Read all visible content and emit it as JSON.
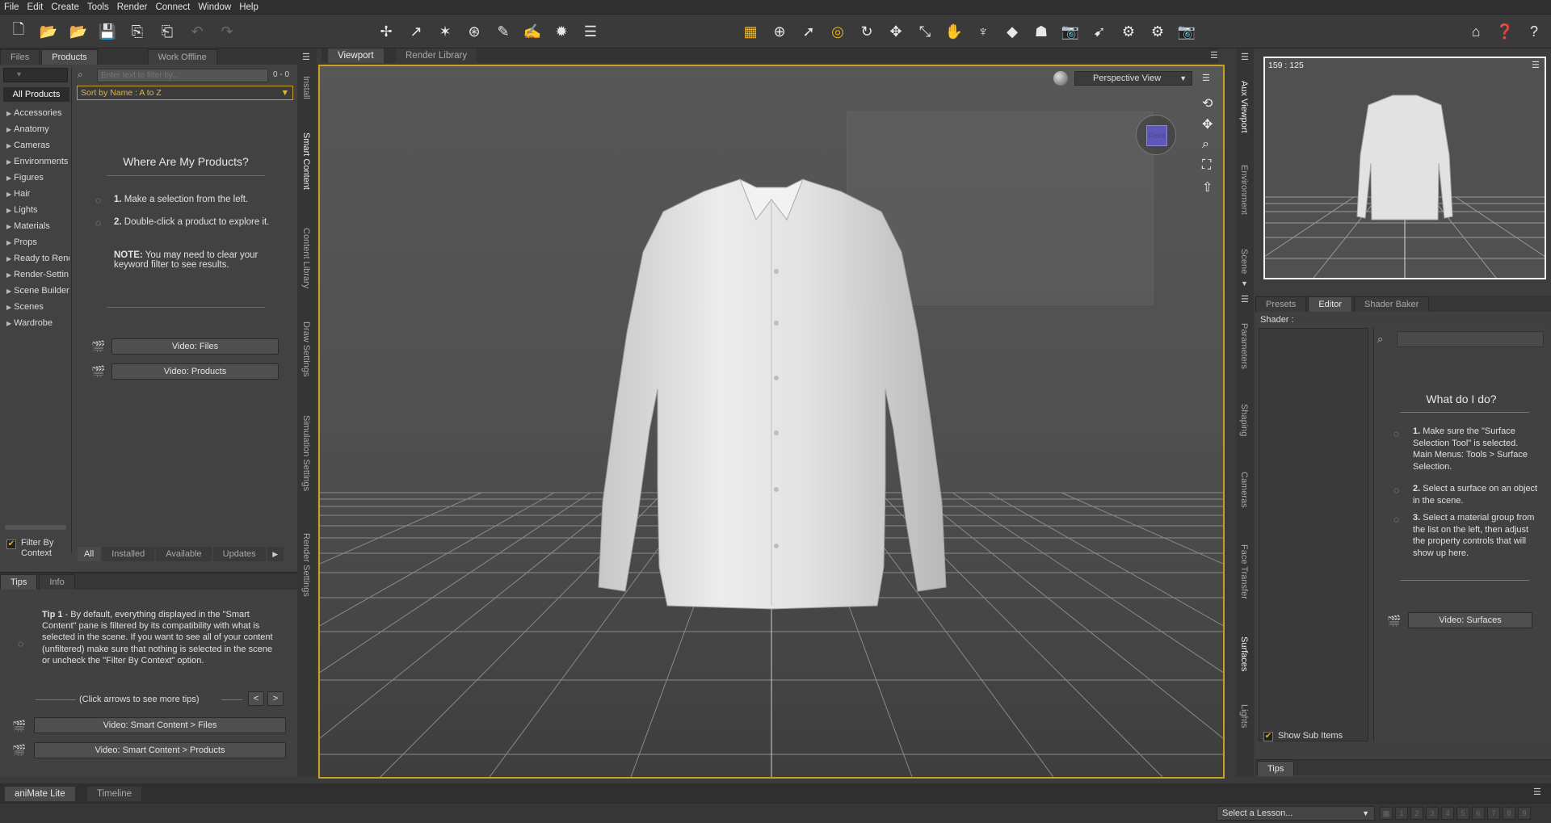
{
  "menu": [
    "File",
    "Edit",
    "Create",
    "Tools",
    "Render",
    "Connect",
    "Window",
    "Help"
  ],
  "left": {
    "tabs": {
      "files": "Files",
      "products": "Products",
      "offline": "Work Offline"
    },
    "filter_placeholder": "Enter text to filter by...",
    "filter_count": "0 - 0",
    "sort": "Sort by Name : A to Z",
    "all_products": "All Products",
    "categories": [
      "Accessories",
      "Anatomy",
      "Cameras",
      "Environments",
      "Figures",
      "Hair",
      "Lights",
      "Materials",
      "Props",
      "Ready to Rend",
      "Render-Settin",
      "Scene Builder",
      "Scenes",
      "Wardrobe"
    ],
    "where_title": "Where Are My Products?",
    "step1_num": "1.",
    "step1": "Make a selection from the left.",
    "step2_num": "2.",
    "step2": "Double-click a product to explore it.",
    "note_label": "NOTE:",
    "note": "You may need to clear your keyword filter to see results.",
    "video_files": "Video: Files",
    "video_products": "Video: Products",
    "filter_by_context": "Filter By Context",
    "subtabs": [
      "All",
      "Installed",
      "Available",
      "Updates"
    ],
    "tips_tab": "Tips",
    "info_tab": "Info",
    "tip_label": "Tip 1",
    "tip_text": "- By default, everything displayed in the \"Smart Content\" pane is filtered by its compatibility with what is selected in the scene. If you want to see all of your content (unfiltered) make sure that nothing is selected in the scene or uncheck the \"Filter By Context\" option.",
    "tips_nav": "(Click arrows to see more tips)",
    "prev": "<",
    "next": ">",
    "video_sc_files": "Video: Smart Content > Files",
    "video_sc_products": "Video: Smart Content > Products",
    "vtabs": [
      "Install",
      "Smart Content",
      "Content Library",
      "Draw Settings",
      "Simulation Settings",
      "Render Settings"
    ]
  },
  "viewport": {
    "tab": "Viewport",
    "render_library": "Render Library",
    "view_mode": "Perspective View",
    "cube_label": "Front"
  },
  "right": {
    "aux_readout": "159 : 125",
    "vtabs_top": [
      "Aux Viewport",
      "Environment",
      "Scene"
    ],
    "vtabs": [
      "Parameters",
      "Shaping",
      "Cameras",
      "Face Transfer",
      "Surfaces",
      "Lights"
    ],
    "tabs": [
      "Presets",
      "Editor",
      "Shader Baker"
    ],
    "shader_label": "Shader :",
    "what_title": "What do I do?",
    "step1_num": "1.",
    "step1": "Make sure the \"Surface Selection Tool\" is selected. Main Menus: Tools > Surface Selection.",
    "step2_num": "2.",
    "step2": "Select a surface on an object in the scene.",
    "step3_num": "3.",
    "step3": "Select a material group from the list on the left, then adjust the property controls that will show up here.",
    "video_surfaces": "Video: Surfaces",
    "show_sub": "Show Sub Items",
    "tips_tab": "Tips"
  },
  "bottom": {
    "tabs": [
      "aniMate Lite",
      "Timeline"
    ],
    "lesson": "Select a Lesson...",
    "pages": [
      "1",
      "2",
      "3",
      "4",
      "5",
      "6",
      "7",
      "8",
      "9"
    ]
  },
  "colors": {
    "accent": "#e8b520",
    "panel": "#424242",
    "viewport_bg": "#555555"
  }
}
